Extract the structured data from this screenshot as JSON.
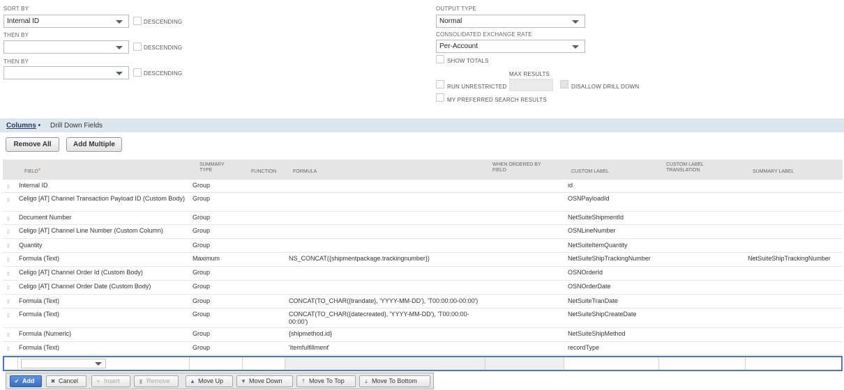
{
  "sort": {
    "sort_by_label": "SORT BY",
    "sort_by_value": "Internal ID",
    "then_by_1_label": "THEN BY",
    "then_by_1_value": "",
    "then_by_2_label": "THEN BY",
    "then_by_2_value": "",
    "descending_label": "DESCENDING"
  },
  "output": {
    "output_type_label": "OUTPUT TYPE",
    "output_type_value": "Normal",
    "exchange_rate_label": "CONSOLIDATED EXCHANGE RATE",
    "exchange_rate_value": "Per-Account",
    "show_totals_label": "SHOW TOTALS",
    "max_results_label": "MAX RESULTS",
    "run_unrestricted_label": "RUN UNRESTRICTED",
    "disallow_drill_down_label": "DISALLOW DRILL DOWN",
    "preferred_results_label": "MY PREFERRED SEARCH RESULTS"
  },
  "tabs": {
    "columns": "Columns",
    "columns_dot": "•",
    "drill_down": "Drill Down Fields"
  },
  "buttons": {
    "remove_all": "Remove All",
    "add_multiple": "Add Multiple"
  },
  "grid": {
    "headers": {
      "field": "FIELD",
      "required_mark": "*",
      "summary_type_1": "SUMMARY",
      "summary_type_2": "TYPE",
      "function": "FUNCTION",
      "formula": "FORMULA",
      "when_ordered_1": "WHEN ORDERED BY",
      "when_ordered_2": "FIELD",
      "custom_label": "CUSTOM LABEL",
      "translation_1": "CUSTOM LABEL",
      "translation_2": "TRANSLATION",
      "summary_label": "SUMMARY LABEL"
    },
    "rows": [
      {
        "field": "Internal ID",
        "summary": "Group",
        "formula": "",
        "custom_label": "id",
        "summary_label": ""
      },
      {
        "field": "Celigo [AT] Channel Transaction Payload ID (Custom Body)",
        "summary": "Group",
        "formula": "",
        "custom_label": "OSNPayloadId",
        "summary_label": ""
      },
      {
        "field": "Document Number",
        "summary": "Group",
        "formula": "",
        "custom_label": "NetSuiteShipmentId",
        "summary_label": ""
      },
      {
        "field": "Celigo [AT] Channel Line Number (Custom Column)",
        "summary": "Group",
        "formula": "",
        "custom_label": "OSNLineNumber",
        "summary_label": ""
      },
      {
        "field": "Quantity",
        "summary": "Group",
        "formula": "",
        "custom_label": "NetSuiteItemQuantity",
        "summary_label": ""
      },
      {
        "field": "Formula (Text)",
        "summary": "Maximum",
        "formula": "NS_CONCAT({shipmentpackage.trackingnumber})",
        "custom_label": "NetSuiteShipTrackingNumber",
        "summary_label": "NetSuiteShipTrackingNumber"
      },
      {
        "field": "Celigo [AT] Channel Order Id (Custom Body)",
        "summary": "Group",
        "formula": "",
        "custom_label": "OSNOrderId",
        "summary_label": ""
      },
      {
        "field": "Celigo [AT] Channel Order Date (Custom Body)",
        "summary": "Group",
        "formula": "",
        "custom_label": "OSNOrderDate",
        "summary_label": ""
      },
      {
        "field": "Formula (Text)",
        "summary": "Group",
        "formula": "CONCAT(TO_CHAR({trandate}, 'YYYY-MM-DD'), 'T00:00:00-00:00')",
        "custom_label": "NetSuiteTranDate",
        "summary_label": ""
      },
      {
        "field": "Formula (Text)",
        "summary": "Group",
        "formula": "CONCAT(TO_CHAR({datecreated}, 'YYYY-MM-DD'), 'T00:00:00-00:00')",
        "custom_label": "NetSuiteShipCreateDate",
        "summary_label": ""
      },
      {
        "field": "Formula (Numeric)",
        "summary": "Group",
        "formula": "{shipmethod.id}",
        "custom_label": "NetSuiteShipMethod",
        "summary_label": ""
      },
      {
        "field": "Formula (Text)",
        "summary": "Group",
        "formula": "'itemfulfillment'",
        "custom_label": "recordType",
        "summary_label": ""
      }
    ]
  },
  "actions": {
    "add": "Add",
    "cancel": "Cancel",
    "insert": "Insert",
    "remove": "Remove",
    "move_up": "Move Up",
    "move_down": "Move Down",
    "move_to_top": "Move To Top",
    "move_to_bottom": "Move To Bottom"
  }
}
